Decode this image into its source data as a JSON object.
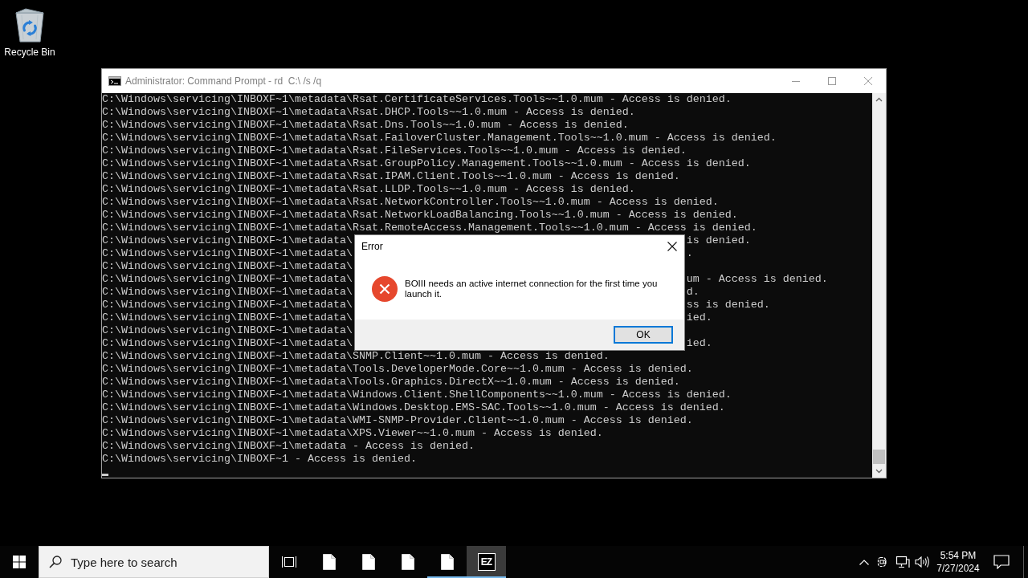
{
  "desktop_icons": [
    {
      "label": "Recycle Bin"
    }
  ],
  "console_window": {
    "title": "Administrator: Command Prompt - rd  C:\\ /s /q",
    "lines": [
      {
        "text": "C:\\Windows\\servicing\\INBOXF~1\\metadata\\Rsat.CertificateServices.Tools~~1.0.mum - Access is denied."
      },
      {
        "text": "C:\\Windows\\servicing\\INBOXF~1\\metadata\\Rsat.DHCP.Tools~~1.0.mum - Access is denied."
      },
      {
        "text": "C:\\Windows\\servicing\\INBOXF~1\\metadata\\Rsat.Dns.Tools~~1.0.mum - Access is denied."
      },
      {
        "text": "C:\\Windows\\servicing\\INBOXF~1\\metadata\\Rsat.FailoverCluster.Management.Tools~~1.0.mum - Access is denied."
      },
      {
        "text": "C:\\Windows\\servicing\\INBOXF~1\\metadata\\Rsat.FileServices.Tools~~1.0.mum - Access is denied."
      },
      {
        "text": "C:\\Windows\\servicing\\INBOXF~1\\metadata\\Rsat.GroupPolicy.Management.Tools~~1.0.mum - Access is denied."
      },
      {
        "text": "C:\\Windows\\servicing\\INBOXF~1\\metadata\\Rsat.IPAM.Client.Tools~~1.0.mum - Access is denied."
      },
      {
        "text": "C:\\Windows\\servicing\\INBOXF~1\\metadata\\Rsat.LLDP.Tools~~1.0.mum - Access is denied."
      },
      {
        "text": "C:\\Windows\\servicing\\INBOXF~1\\metadata\\Rsat.NetworkController.Tools~~1.0.mum - Access is denied."
      },
      {
        "text": "C:\\Windows\\servicing\\INBOXF~1\\metadata\\Rsat.NetworkLoadBalancing.Tools~~1.0.mum - Access is denied."
      },
      {
        "text": "C:\\Windows\\servicing\\INBOXF~1\\metadata\\Rsat.RemoteAccess.Management.Tools~~1.0.mum - Access is denied."
      },
      {
        "text": "C:\\Windows\\servicing\\INBOXF~1\\metadata\\",
        "tail": "is denied."
      },
      {
        "text": "C:\\Windows\\servicing\\INBOXF~1\\metadata\\",
        "tail": "."
      },
      {
        "text": "C:\\Windows\\servicing\\INBOXF~1\\metadata\\"
      },
      {
        "text": "C:\\Windows\\servicing\\INBOXF~1\\metadata\\",
        "tail": "um - Access is denied."
      },
      {
        "text": "C:\\Windows\\servicing\\INBOXF~1\\metadata\\",
        "tail": "d."
      },
      {
        "text": "C:\\Windows\\servicing\\INBOXF~1\\metadata\\",
        "tail": "ss is denied."
      },
      {
        "text": "C:\\Windows\\servicing\\INBOXF~1\\metadata\\",
        "tail": "ied."
      },
      {
        "text": "C:\\Windows\\servicing\\INBOXF~1\\metadata\\"
      },
      {
        "text": "C:\\Windows\\servicing\\INBOXF~1\\metadata\\",
        "tail": "ied."
      },
      {
        "text": "C:\\Windows\\servicing\\INBOXF~1\\metadata\\SNMP.Client~~1.0.mum - Access is denied."
      },
      {
        "text": "C:\\Windows\\servicing\\INBOXF~1\\metadata\\Tools.DeveloperMode.Core~~1.0.mum - Access is denied."
      },
      {
        "text": "C:\\Windows\\servicing\\INBOXF~1\\metadata\\Tools.Graphics.DirectX~~1.0.mum - Access is denied."
      },
      {
        "text": "C:\\Windows\\servicing\\INBOXF~1\\metadata\\Windows.Client.ShellComponents~~1.0.mum - Access is denied."
      },
      {
        "text": "C:\\Windows\\servicing\\INBOXF~1\\metadata\\Windows.Desktop.EMS-SAC.Tools~~1.0.mum - Access is denied."
      },
      {
        "text": "C:\\Windows\\servicing\\INBOXF~1\\metadata\\WMI-SNMP-Provider.Client~~1.0.mum - Access is denied."
      },
      {
        "text": "C:\\Windows\\servicing\\INBOXF~1\\metadata\\XPS.Viewer~~1.0.mum - Access is denied."
      },
      {
        "text": "C:\\Windows\\servicing\\INBOXF~1\\metadata - Access is denied."
      },
      {
        "text": "C:\\Windows\\servicing\\INBOXF~1 - Access is denied."
      }
    ]
  },
  "dialog": {
    "title": "Error",
    "message": "BOIII needs an active internet connection for the first time you launch it.",
    "buttons": [
      {
        "label": "OK",
        "focused": true
      }
    ]
  },
  "taskbar": {
    "search": {
      "placeholder": "Type here to search"
    },
    "apps": [
      {
        "kind": "file",
        "running": false,
        "selected": false
      },
      {
        "kind": "file",
        "running": false,
        "selected": false
      },
      {
        "kind": "file",
        "running": false,
        "selected": false
      },
      {
        "kind": "file",
        "running": true,
        "selected": false
      },
      {
        "kind": "app",
        "label": "EZ",
        "running": true,
        "selected": true
      }
    ],
    "clock": {
      "time": "5:54 PM",
      "date": "7/27/2024"
    }
  }
}
